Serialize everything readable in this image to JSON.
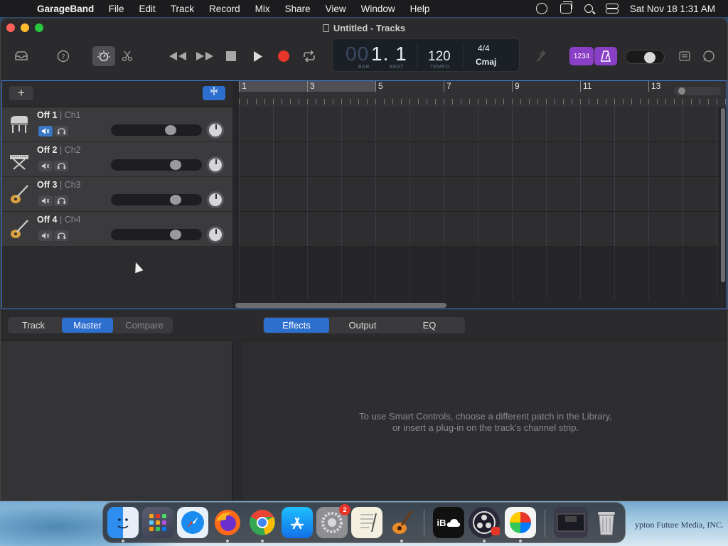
{
  "menubar": {
    "app_name": "GarageBand",
    "items": [
      "File",
      "Edit",
      "Track",
      "Record",
      "Mix",
      "Share",
      "View",
      "Window",
      "Help"
    ],
    "clock": "Sat Nov 18  1:31 AM"
  },
  "window": {
    "title": "Untitled - Tracks"
  },
  "lcd": {
    "position_dim": "00",
    "position": "1. 1",
    "bar_label": "BAR",
    "beat_label": "BEAT",
    "tempo": "120",
    "tempo_label": "TEMPO",
    "time_signature": "4/4",
    "key": "Cmaj"
  },
  "toolbar": {
    "count_in_label": "1234",
    "add_track_label": "+"
  },
  "tracks": [
    {
      "name": "Off 1",
      "channel": "| Ch1",
      "icon": "grand-piano-icon",
      "muted": true,
      "volume": 0.68
    },
    {
      "name": "Off 2",
      "channel": "| Ch2",
      "icon": "keyboard-stand-icon",
      "muted": false,
      "volume": 0.74
    },
    {
      "name": "Off 3",
      "channel": "| Ch3",
      "icon": "electric-guitar-icon",
      "muted": false,
      "volume": 0.74
    },
    {
      "name": "Off 4",
      "channel": "| Ch4",
      "icon": "electric-guitar-icon",
      "muted": false,
      "volume": 0.74
    }
  ],
  "ruler": {
    "bars": [
      "1",
      "3",
      "5",
      "7",
      "9",
      "11",
      "13"
    ]
  },
  "lower_panel": {
    "left_tabs": [
      {
        "label": "Track",
        "selected": false
      },
      {
        "label": "Master",
        "selected": true
      },
      {
        "label": "Compare",
        "selected": false
      }
    ],
    "right_tabs": [
      {
        "label": "Effects",
        "selected": true
      },
      {
        "label": "Output",
        "selected": false
      },
      {
        "label": "EQ",
        "selected": false
      }
    ],
    "message_line1": "To use Smart Controls, choose a different patch in the Library,",
    "message_line2": "or insert a plug-in on the track’s channel strip."
  },
  "dock": {
    "system_preferences_badge": "2",
    "icloud_label": "iB"
  },
  "wallpaper_text": "ypton Future Media, INC.",
  "colors": {
    "accent": "#2c6fce",
    "record": "#e8352a",
    "purple": "#8a3fc7",
    "selection_border": "#3d7fd6"
  }
}
